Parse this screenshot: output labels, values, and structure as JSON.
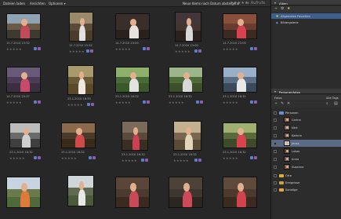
{
  "toolbar": {
    "menu": [
      "Dateien laden",
      "Ansichten",
      "Optionen ▾"
    ],
    "sort": "Neue Items nach Datum absteigend",
    "compare": "≥ Aufrufe"
  },
  "photos": [
    {
      "date": "15.7.2010 15:32"
    },
    {
      "date": "15.7.2010 15:32"
    },
    {
      "date": "14.7.2010 23:00"
    },
    {
      "date": "14.7.2010 23:00"
    },
    {
      "date": "14.7.2010 23:00"
    },
    {
      "date": "14.7.2010 20:37"
    },
    {
      "date": "23.1.2010 16:39"
    },
    {
      "date": "23.1.2010 16:32"
    },
    {
      "date": "23.1.2010 16:32"
    },
    {
      "date": "23.1.2010 16:32"
    },
    {
      "date": "23.1.2010 16:32"
    },
    {
      "date": "23.1.2010 16:32"
    },
    {
      "date": "23.1.2010 16:32"
    },
    {
      "date": "23.1.2010 16:32"
    },
    {
      "date": "23.1.2010 16:32"
    },
    {
      "date": ""
    },
    {
      "date": ""
    },
    {
      "date": ""
    },
    {
      "date": ""
    },
    {
      "date": ""
    }
  ],
  "albums_panel": {
    "title": "Alben",
    "items": [
      "Allgemeine Favoriten",
      "Bildergalerie"
    ]
  },
  "tags_panel": {
    "title": "Personenfotos",
    "tabs": [
      "Fotos",
      "Alle Tags"
    ],
    "root": "Personen",
    "people": [
      "Carina",
      "Nick",
      "Kathrin",
      "Jonas",
      "Lukas",
      "Anna",
      "Susanne"
    ],
    "folders": [
      "Orte",
      "Ereignisse",
      "Sonstige"
    ]
  },
  "colors": {
    "badge_blue": "#5b7fc6",
    "badge_purple": "#8f5db0",
    "selection": "#3d5f8e"
  }
}
